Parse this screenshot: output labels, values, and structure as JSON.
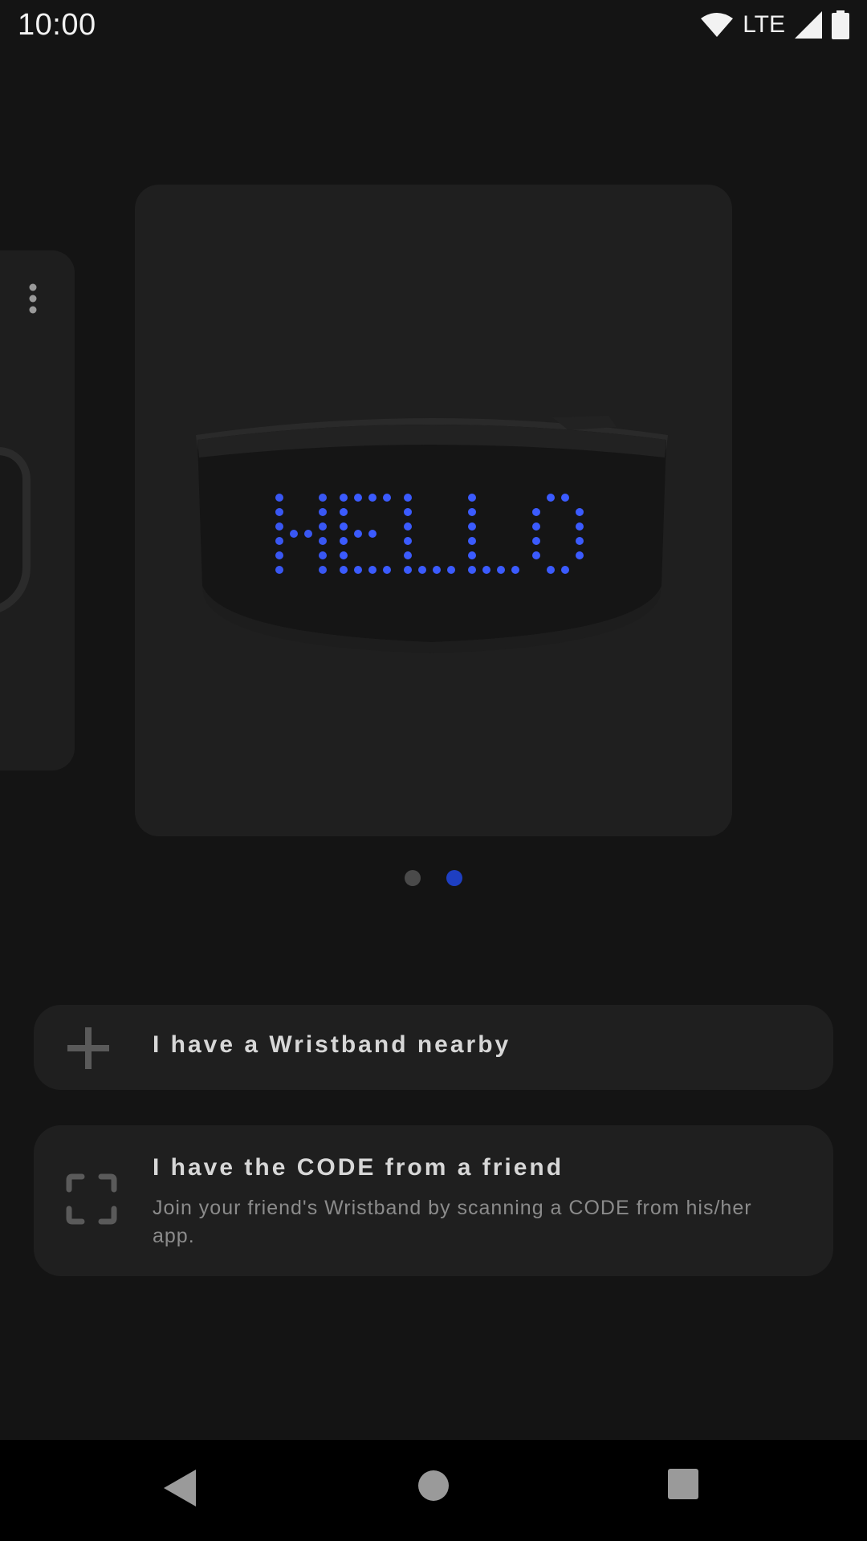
{
  "status_bar": {
    "time": "10:00",
    "network": "LTE",
    "icons": [
      "wifi-icon",
      "cell-signal-icon",
      "battery-icon"
    ]
  },
  "carousel": {
    "cards": [
      {
        "name": "previous-wristband-card",
        "menu_icon": "more-vert-icon"
      },
      {
        "name": "wristband-card",
        "display_text": "HELLO"
      }
    ],
    "page_indicator": {
      "count": 2,
      "active_index": 1
    }
  },
  "options": {
    "nearby": {
      "icon": "plus-icon",
      "title": "I have a Wristband nearby"
    },
    "code": {
      "icon": "scan-frame-icon",
      "title": "I have the CODE from a friend",
      "description": "Join your friend's Wristband by scanning a CODE from his/her app."
    }
  },
  "nav_bar": {
    "icons": [
      "back-icon",
      "home-icon",
      "recents-icon"
    ]
  },
  "colors": {
    "background": "#141414",
    "card": "#1f1f1f",
    "accent": "#1e3fc2",
    "led": "#3b5bff"
  }
}
